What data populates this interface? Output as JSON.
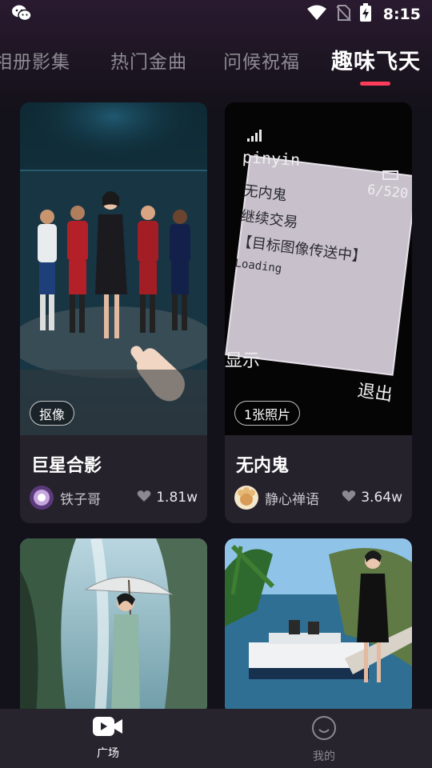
{
  "status_bar": {
    "time": "8:15",
    "icons": [
      "wechat-icon",
      "wifi-icon",
      "no-sim-icon",
      "battery-charging-icon"
    ]
  },
  "tabs": [
    {
      "label": "相册影集",
      "active": false
    },
    {
      "label": "热门金曲",
      "active": false
    },
    {
      "label": "问候祝福",
      "active": false
    },
    {
      "label": "趣味飞天",
      "active": true
    }
  ],
  "accent_color": "#ff3d5a",
  "cards": [
    {
      "title": "巨星合影",
      "badge": "抠像",
      "author": "铁子哥",
      "likes": "1.81w"
    },
    {
      "title": "无内鬼",
      "badge": "1张照片",
      "author": "静心禅语",
      "likes": "3.64w",
      "phone_screen": {
        "header": "pinyin",
        "counter": "6/520",
        "lines": [
          "无内鬼",
          "继续交易",
          "【目标图像传送中】",
          "Loading"
        ],
        "left_key": "显示",
        "right_key": "退出"
      }
    },
    {
      "title": "",
      "badge": ""
    },
    {
      "title": "",
      "badge": ""
    }
  ],
  "bottom_nav": [
    {
      "label": "广场",
      "icon": "video-play-icon",
      "active": true
    },
    {
      "label": "我的",
      "icon": "smiley-face-icon",
      "active": false
    }
  ]
}
